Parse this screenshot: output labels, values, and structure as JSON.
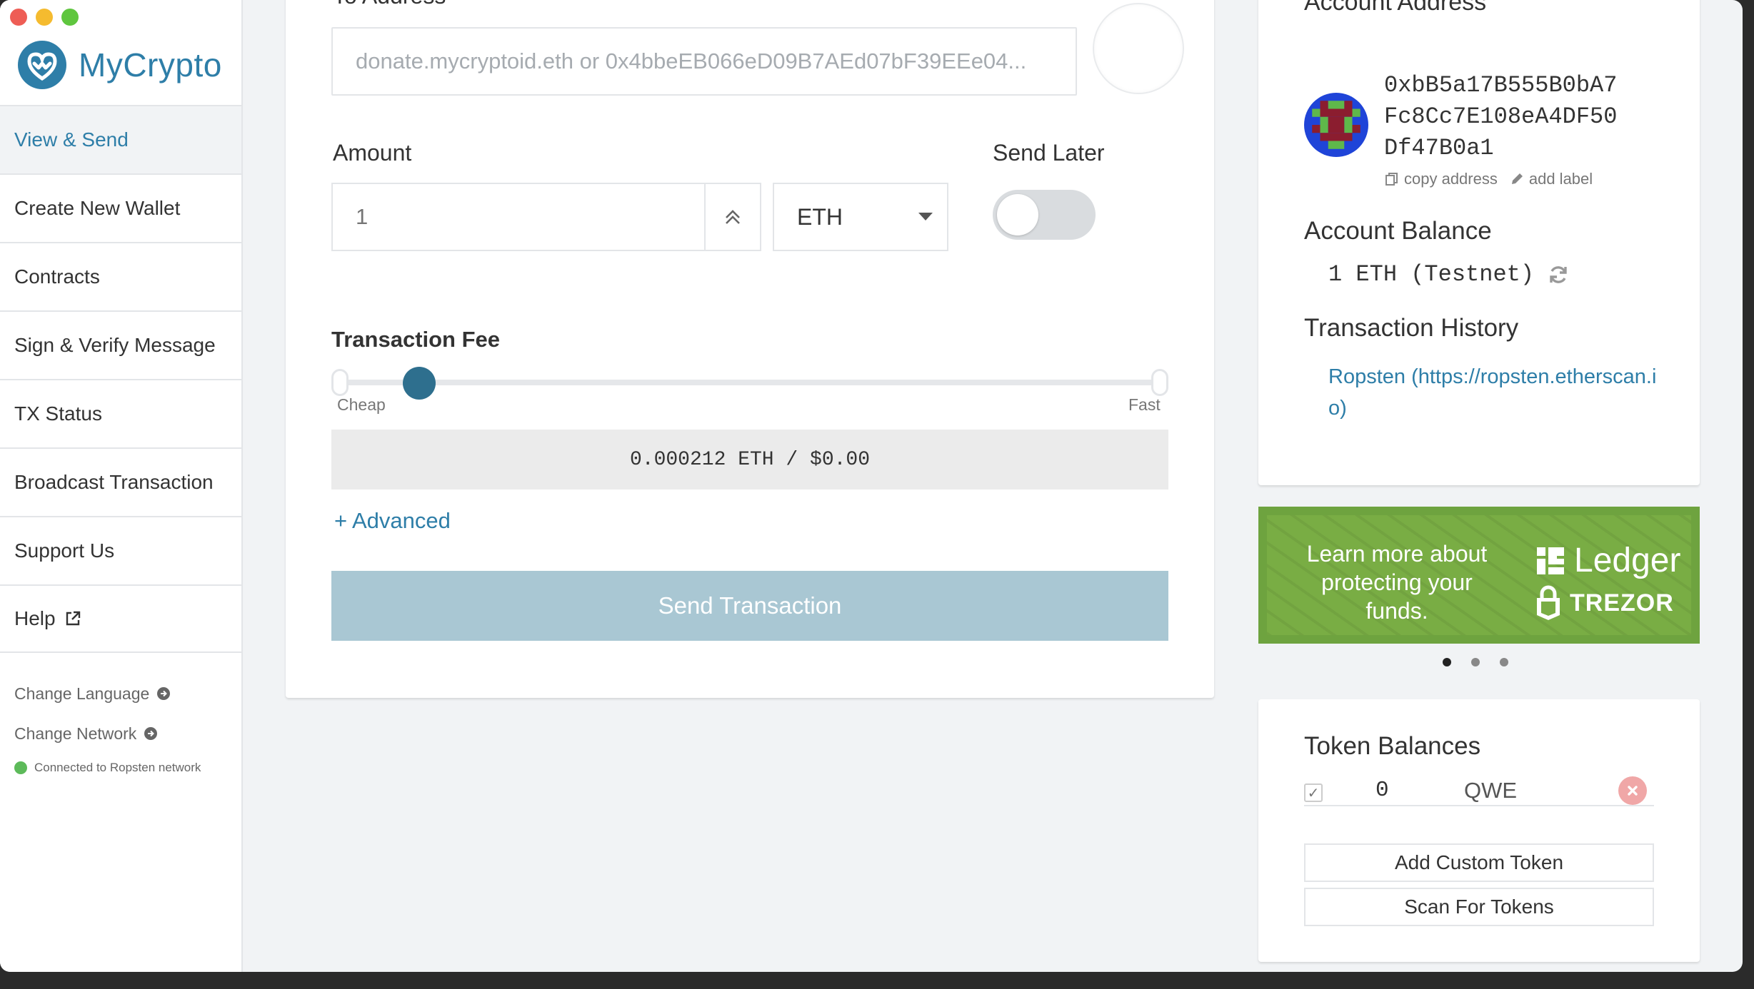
{
  "app": {
    "name": "MyCrypto"
  },
  "colors": {
    "brand": "#2e7ea8",
    "connected": "#5dba5a",
    "send_button": "#a9c7d3",
    "promo": "#79ad44"
  },
  "sidebar": {
    "items": [
      {
        "label": "View & Send",
        "active": true
      },
      {
        "label": "Create New Wallet"
      },
      {
        "label": "Contracts"
      },
      {
        "label": "Sign & Verify Message"
      },
      {
        "label": "TX Status"
      },
      {
        "label": "Broadcast Transaction"
      },
      {
        "label": "Support Us"
      },
      {
        "label": "Help"
      }
    ],
    "change_language": "Change Language",
    "change_network": "Change Network",
    "connection_status": "Connected to Ropsten network"
  },
  "send": {
    "to_label": "To Address",
    "to_placeholder": "donate.mycryptoid.eth or 0x4bbeEB066eD09B7AEd07bF39EEe04...",
    "amount_label": "Amount",
    "amount_placeholder": "1",
    "unit": "ETH",
    "send_later_label": "Send Later",
    "send_later_on": false,
    "fee_label": "Transaction Fee",
    "fee_slider_level": 0.08,
    "cheap_label": "Cheap",
    "fast_label": "Fast",
    "fee_display": "0.000212 ETH / $0.00",
    "advanced_label": "+ Advanced",
    "send_button": "Send Transaction"
  },
  "account": {
    "heading": "Account Address",
    "address_lines": [
      "0xbB5a17B555B0bA7",
      "Fc8Cc7E108eA4DF50",
      "Df47B0a1"
    ],
    "copy_label": "copy address",
    "add_label": "add label",
    "balance_heading": "Account Balance",
    "balance": "1 ETH (Testnet)",
    "history_heading": "Transaction History",
    "history_link": "Ropsten (https://ropsten.etherscan.io)"
  },
  "promo": {
    "text": "Learn more about protecting your funds.",
    "ledger": "Ledger",
    "trezor": "TREZOR",
    "slides": 3,
    "active_slide": 1
  },
  "tokens": {
    "heading": "Token Balances",
    "rows": [
      {
        "balance": "0",
        "symbol": "QWE"
      }
    ],
    "add_custom": "Add Custom Token",
    "scan": "Scan For Tokens"
  }
}
